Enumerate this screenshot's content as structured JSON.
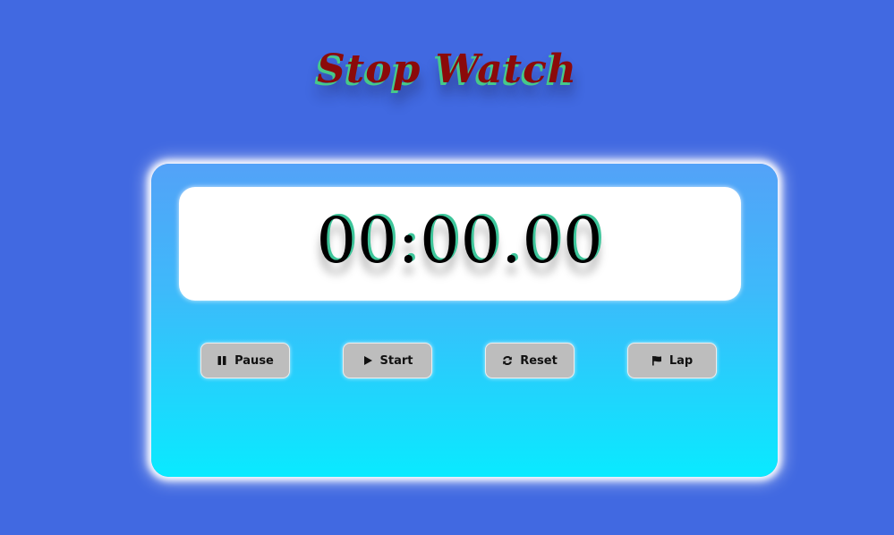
{
  "header": {
    "title": "Stop Watch"
  },
  "display": {
    "time": "00:00.00"
  },
  "controls": [
    {
      "label": "Pause",
      "icon": "pause-icon"
    },
    {
      "label": "Start",
      "icon": "play-icon"
    },
    {
      "label": "Reset",
      "icon": "refresh-icon"
    },
    {
      "label": "Lap",
      "icon": "flag-icon"
    }
  ],
  "colors": {
    "background": "#4169e1",
    "title": "#8b0a0a",
    "title_shadow": "#46c98a",
    "card_top": "#53a2f8",
    "card_bottom": "#09eaff",
    "button": "#bdbdbd"
  }
}
